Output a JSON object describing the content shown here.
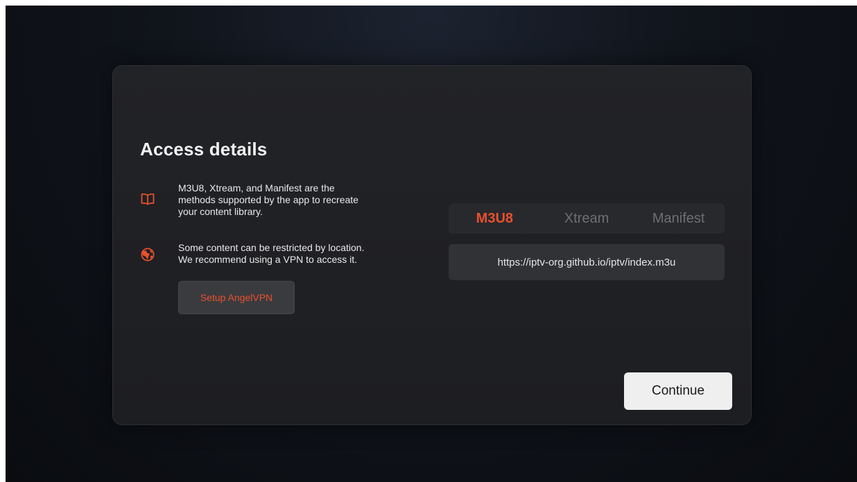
{
  "card": {
    "title": "Access details",
    "info": [
      {
        "icon": "book-icon",
        "text": "M3U8, Xtream, and Manifest are the\nmethods supported by the app to recreate\nyour content library."
      },
      {
        "icon": "globe-icon",
        "text": "Some content can be restricted by location.\nWe recommend using a VPN to access it."
      }
    ],
    "vpn_button": "Setup AngelVPN"
  },
  "tabs": {
    "items": [
      {
        "label": "M3U8",
        "active": true
      },
      {
        "label": "Xtream",
        "active": false
      },
      {
        "label": "Manifest",
        "active": false
      }
    ]
  },
  "url_input": {
    "value": "https://iptv-org.github.io/iptv/index.m3u"
  },
  "continue_button": "Continue",
  "colors": {
    "accent": "#e8502c",
    "card_background": "#202124",
    "continue_background": "#efefef"
  }
}
